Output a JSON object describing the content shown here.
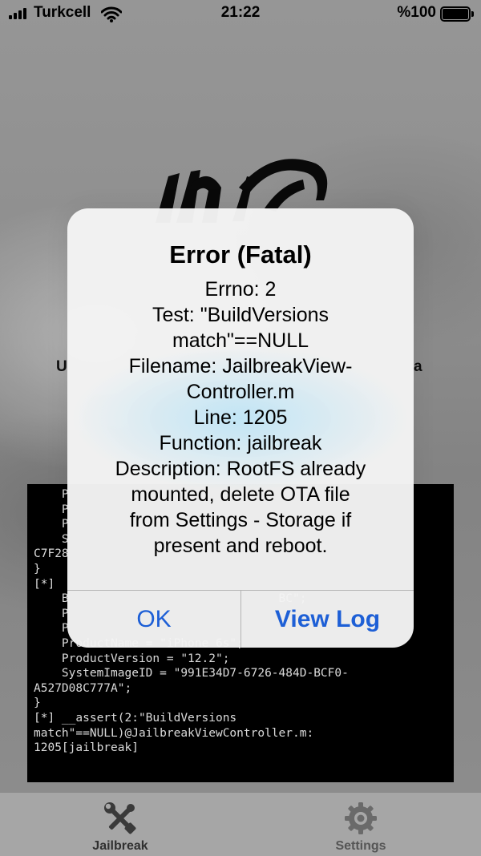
{
  "status_bar": {
    "carrier": "Turkcell",
    "time": "21:22",
    "battery_percent": "%100",
    "icons": [
      "signal-icon",
      "wifi-icon",
      "battery-icon"
    ]
  },
  "background": {
    "text_left": "U",
    "text_right": "a"
  },
  "console": {
    "lines": [
      "    P",
      "    P",
      "    P",
      "    S",
      "C7F28",
      "}",
      "[*] ",
      "    B                              BC\";",
      "    P",
      "    P",
      "    ProductName = \"iPhone 6s\";",
      "    ProductVersion = \"12.2\";",
      "    SystemImageID = \"991E34D7-6726-484D-BCF0-",
      "A527D08C777A\";",
      "}",
      "[*] __assert(2:\"BuildVersions",
      "match\"==NULL)@JailbreakViewController.m:",
      "1205[jailbreak]"
    ]
  },
  "alert": {
    "title": "Error (Fatal)",
    "message_lines": [
      "Errno: 2",
      "Test: \"BuildVersions",
      "match\"==NULL",
      "Filename: JailbreakView-",
      "Controller.m",
      "Line: 1205",
      "Function: jailbreak",
      "Description: RootFS already",
      "mounted, delete OTA file",
      "from Settings - Storage if",
      "present and reboot."
    ],
    "buttons": {
      "ok": "OK",
      "view_log": "View Log"
    },
    "button_color": "#1d5fd6"
  },
  "tab_bar": {
    "items": [
      {
        "label": "Jailbreak",
        "icon": "tools-icon"
      },
      {
        "label": "Settings",
        "icon": "gear-icon"
      }
    ]
  }
}
